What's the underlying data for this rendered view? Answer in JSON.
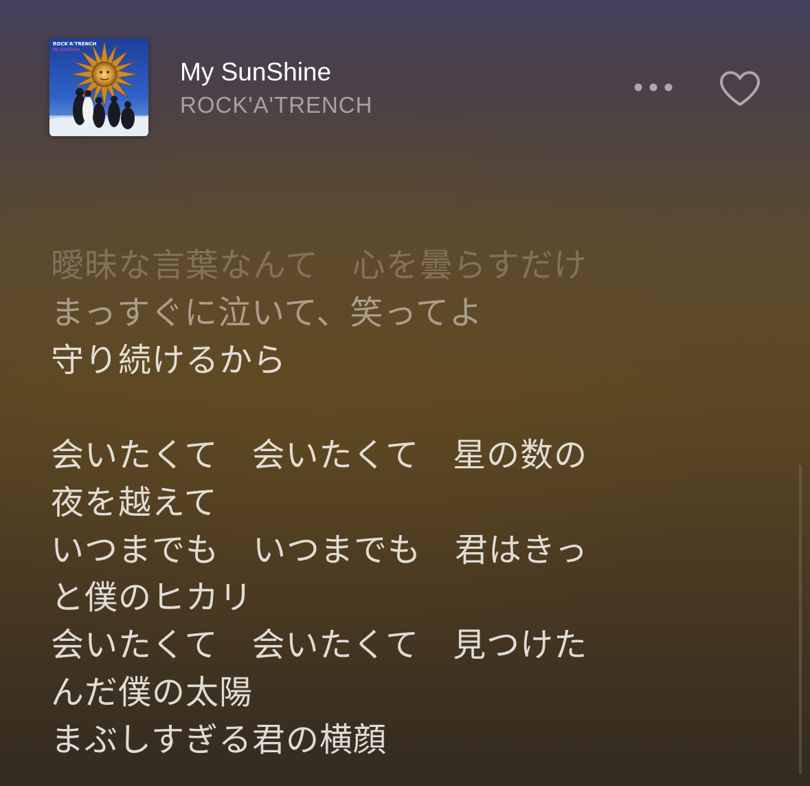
{
  "track": {
    "title": "My SunShine",
    "artist": "ROCK'A'TRENCH"
  },
  "artwork": {
    "band_label": "ROCK'A'TRENCH",
    "single_label": "My SunShine"
  },
  "controls": {
    "more_icon": "more-horizontal-icon",
    "favorite_icon": "heart-outline-icon"
  },
  "lyrics": {
    "lines": [
      "曖昧な言葉なんて　心を曇らすだけ",
      "まっすぐに泣いて、笑ってよ",
      "守り続けるから",
      "",
      "会いたくて　会いたくて　星の数の",
      "夜を越えて",
      "いつまでも　いつまでも　君はきっ",
      "と僕のヒカリ",
      "会いたくて　会いたくて　見つけた",
      "んだ僕の太陽",
      "まぶしすぎる君の横顔"
    ]
  },
  "colors": {
    "background_top": "#44405a",
    "background_mid": "#5c4824",
    "background_bottom": "#332a20",
    "text_primary": "#eeeae6"
  }
}
